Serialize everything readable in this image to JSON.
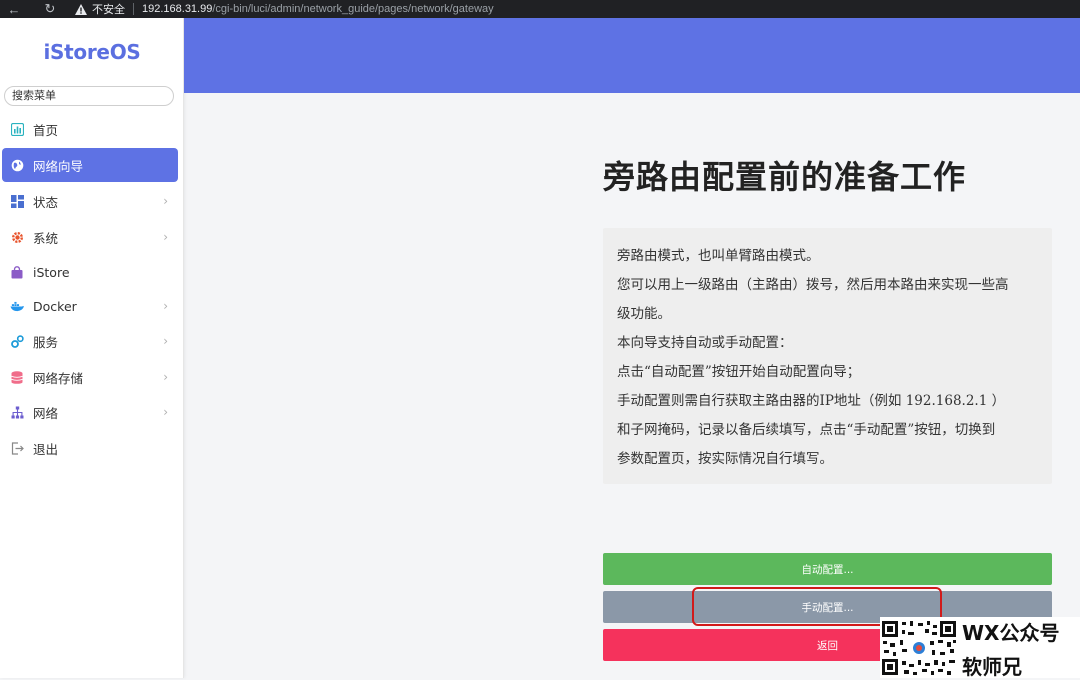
{
  "browser": {
    "insecure_label": "不安全",
    "url_host": "192.168.31.99",
    "url_path": "/cgi-bin/luci/admin/network_guide/pages/network/gateway"
  },
  "sidebar": {
    "logo": "iStoreOS",
    "search_placeholder": "搜索菜单",
    "items": [
      {
        "label": "首页",
        "icon": "dashboard-icon",
        "has_submenu": false,
        "active": false
      },
      {
        "label": "网络向导",
        "icon": "globe-icon",
        "has_submenu": false,
        "active": true
      },
      {
        "label": "状态",
        "icon": "grid-icon",
        "has_submenu": true,
        "active": false
      },
      {
        "label": "系统",
        "icon": "gear-icon",
        "has_submenu": true,
        "active": false
      },
      {
        "label": "iStore",
        "icon": "store-icon",
        "has_submenu": false,
        "active": false
      },
      {
        "label": "Docker",
        "icon": "docker-icon",
        "has_submenu": true,
        "active": false
      },
      {
        "label": "服务",
        "icon": "services-icon",
        "has_submenu": true,
        "active": false
      },
      {
        "label": "网络存储",
        "icon": "storage-icon",
        "has_submenu": true,
        "active": false
      },
      {
        "label": "网络",
        "icon": "network-icon",
        "has_submenu": true,
        "active": false
      },
      {
        "label": "退出",
        "icon": "logout-icon",
        "has_submenu": false,
        "active": false
      }
    ]
  },
  "main": {
    "title": "旁路由配置前的准备工作",
    "description": [
      "旁路由模式，也叫单臂路由模式。",
      "您可以用上一级路由（主路由）拨号，然后用本路由来实现一些高",
      "级功能。",
      "本向导支持自动或手动配置：",
      "点击“自动配置”按钮开始自动配置向导；",
      "手动配置则需自行获取主路由器的IP地址（例如 192.168.2.1 ）",
      "和子网掩码，记录以备后续填写，点击“手动配置”按钮，切换到",
      "参数配置页，按实际情况自行填写。"
    ],
    "buttons": {
      "auto": "自动配置...",
      "manual": "手动配置...",
      "back": "返回"
    }
  },
  "watermark": {
    "line1": "WX公众号",
    "line2": "软师兄"
  },
  "colors": {
    "accent": "#5e72e4",
    "auto_button": "#5cb85c",
    "manual_button": "#8b98a8",
    "back_button": "#f5325c",
    "highlight": "#d11a1a"
  }
}
